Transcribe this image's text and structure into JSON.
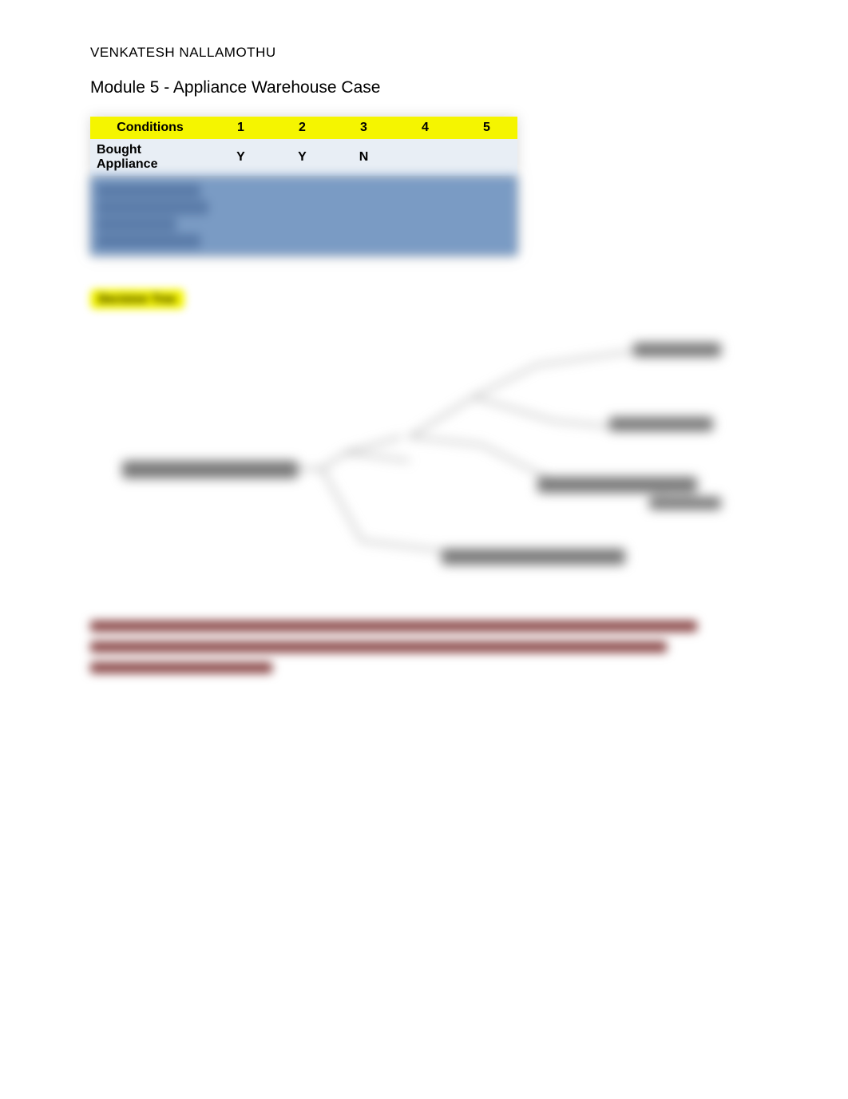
{
  "author": "VENKATESH NALLAMOTHU",
  "title": "Module 5 - Appliance Warehouse Case",
  "table": {
    "headers": [
      "Conditions",
      "1",
      "2",
      "3",
      "4",
      "5"
    ],
    "rows": [
      {
        "label": "Bought Appliance",
        "values": [
          "Y",
          "Y",
          "N",
          "",
          ""
        ]
      }
    ]
  },
  "section_label": "Decision Tree",
  "blurred_paragraph": "The decision tree shows the service plan. If a service plan is not used for more than three years or a year, it ends. If a customer decided to use the service, the customer will have to pay for both the service fee and the parts."
}
